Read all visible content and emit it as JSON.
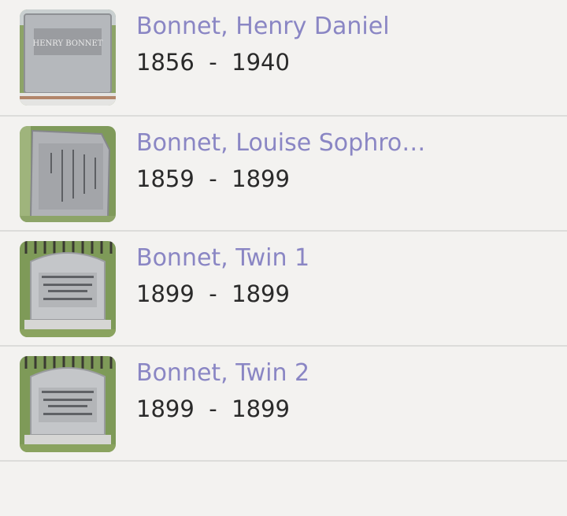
{
  "records": [
    {
      "name": "Bonnet, Henry Daniel",
      "birth": "1856",
      "separator": "-",
      "death": "1940",
      "thumb_inscription": "HENRY BONNET"
    },
    {
      "name": "Bonnet, Louise Sophro…",
      "birth": "1859",
      "separator": "-",
      "death": "1899",
      "thumb_inscription": "IN THE MEMORY OF MRS. LOUISE BONNET"
    },
    {
      "name": "Bonnet, Twin 1",
      "birth": "1899",
      "separator": "-",
      "death": "1899",
      "thumb_inscription": "TWIN INFANTS OF HENRY AND LOUISE BONNET"
    },
    {
      "name": "Bonnet, Twin 2",
      "birth": "1899",
      "separator": "-",
      "death": "1899",
      "thumb_inscription": "TWIN INFANTS OF HENRY AND LOUISE BONNET"
    }
  ],
  "colors": {
    "background": "#f3f2f0",
    "name_link": "#8a86c4",
    "dates_text": "#2a2a2a",
    "divider": "#dcdcda"
  }
}
